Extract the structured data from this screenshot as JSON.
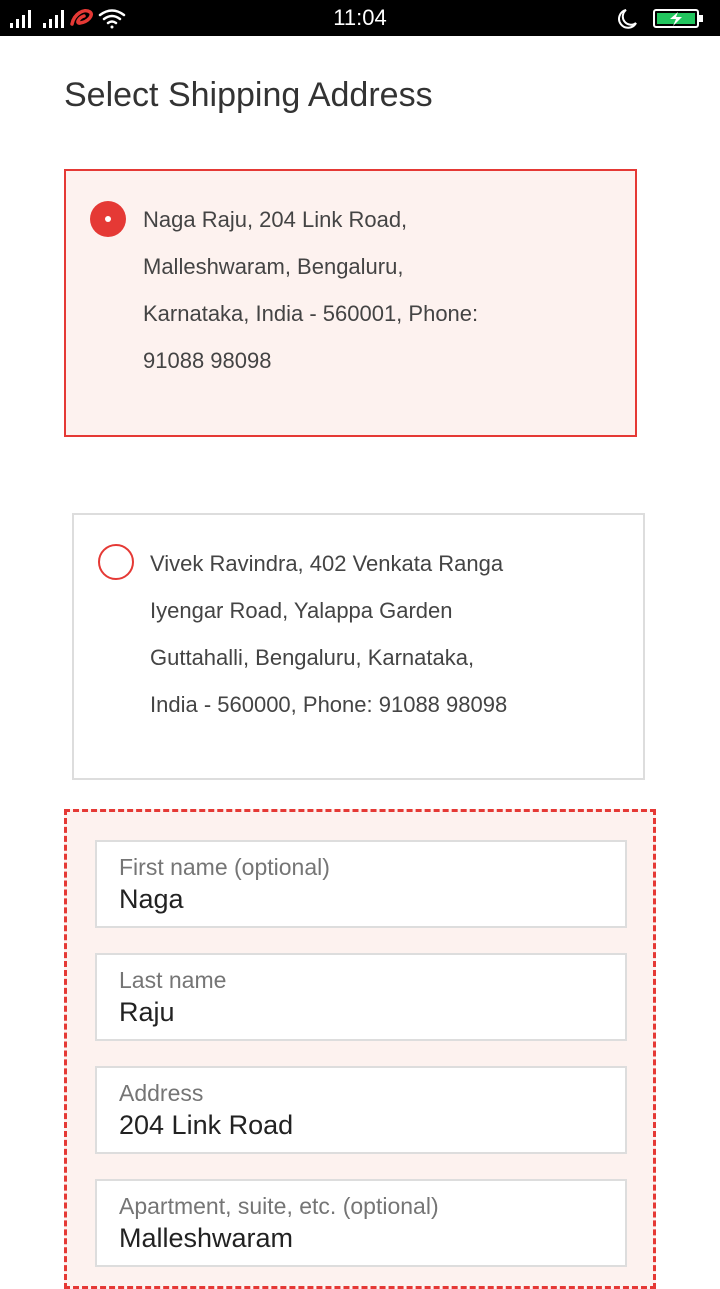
{
  "status_bar": {
    "time": "11:04",
    "icons": [
      "signal-icon",
      "signal-icon",
      "airtel-icon",
      "wifi-icon",
      "moon-icon",
      "battery-charging-icon"
    ],
    "battery_color": "#22c55e"
  },
  "page": {
    "title": "Select Shipping Address"
  },
  "addresses": [
    {
      "selected": true,
      "lines": [
        "Naga Raju, 204 Link Road,",
        "Malleshwaram, Bengaluru,",
        "Karnataka, India - 560001, Phone:",
        "91088 98098"
      ]
    },
    {
      "selected": false,
      "lines": [
        "Vivek Ravindra, 402 Venkata Ranga",
        "Iyengar Road, Yalappa Garden",
        "Guttahalli, Bengaluru, Karnataka,",
        "India - 560000, Phone: 91088 98098"
      ]
    }
  ],
  "form": {
    "fields": [
      {
        "label": "First name (optional)",
        "value": "Naga"
      },
      {
        "label": "Last name",
        "value": "Raju"
      },
      {
        "label": "Address",
        "value": "204 Link Road"
      },
      {
        "label": "Apartment, suite, etc. (optional)",
        "value": "Malleshwaram"
      }
    ]
  },
  "colors": {
    "accent": "#e53935",
    "selected_bg": "#fdf2ef",
    "border": "#dddddd"
  }
}
